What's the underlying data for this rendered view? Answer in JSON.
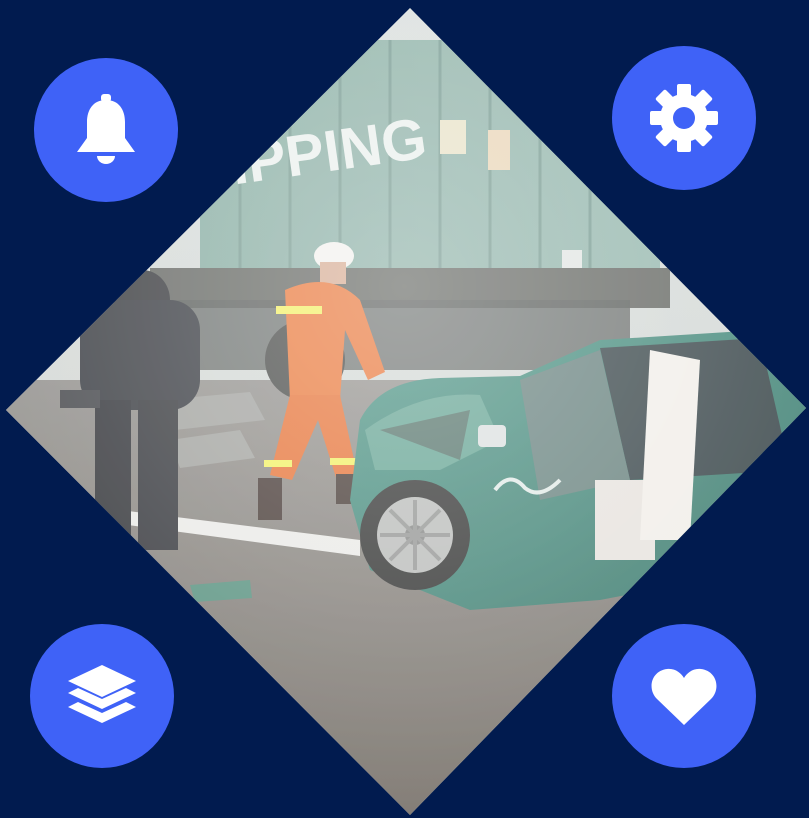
{
  "theme": {
    "background": "#011b4f",
    "button_color": "#3f62f7",
    "icon_color": "#ffffff"
  },
  "photo": {
    "description_icon": "accident-photo",
    "container_text": "IPPING"
  },
  "buttons": [
    {
      "id": "bell",
      "icon": "bell-icon"
    },
    {
      "id": "gear",
      "icon": "gear-icon"
    },
    {
      "id": "layers",
      "icon": "layers-icon"
    },
    {
      "id": "heart",
      "icon": "heart-icon"
    }
  ]
}
